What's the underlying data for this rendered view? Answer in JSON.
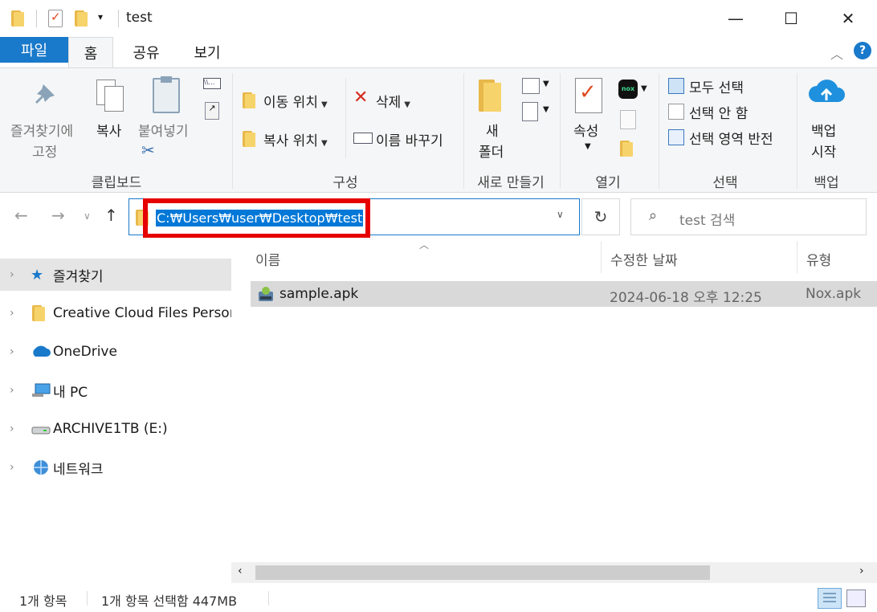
{
  "window": {
    "title": "test",
    "minimize": "—",
    "maximize": "☐",
    "close": "✕"
  },
  "ribbon_tabs": [
    {
      "label": "파일"
    },
    {
      "label": "홈"
    },
    {
      "label": "공유"
    },
    {
      "label": "보기"
    }
  ],
  "ribbon": {
    "clipboard": {
      "pin_line1": "즐겨찾기에",
      "pin_line2": "고정",
      "copy": "복사",
      "paste": "붙여넣기",
      "group": "클립보드"
    },
    "organize": {
      "move_to": "이동 위치",
      "copy_to": "복사 위치",
      "delete": "삭제",
      "rename": "이름 바꾸기",
      "group": "구성"
    },
    "new": {
      "folder_line1": "새",
      "folder_line2": "폴더",
      "group": "새로 만들기"
    },
    "open": {
      "properties": "속성",
      "group": "열기"
    },
    "select": {
      "select_all": "모두 선택",
      "select_none": "선택 안 함",
      "invert": "선택 영역 반전",
      "group": "선택"
    },
    "backup": {
      "start_line1": "백업",
      "start_line2": "시작",
      "group": "백업"
    }
  },
  "address": {
    "path": "C:₩Users₩user₩Desktop₩test",
    "search_placeholder": "test 검색"
  },
  "nav": [
    {
      "label": "즐겨찾기",
      "icon": "star-icon"
    },
    {
      "label": "Creative Cloud Files Person",
      "icon": "folder-icon"
    },
    {
      "label": "OneDrive",
      "icon": "cloud-icon"
    },
    {
      "label": "내 PC",
      "icon": "pc-icon"
    },
    {
      "label": "ARCHIVE1TB (E:)",
      "icon": "drive-icon"
    },
    {
      "label": "네트워크",
      "icon": "network-icon"
    }
  ],
  "columns": {
    "name": "이름",
    "modified": "수정한 날짜",
    "type": "유형"
  },
  "files": [
    {
      "name": "sample.apk",
      "modified": "2024-06-18 오후 12:25",
      "type": "Nox.apk"
    }
  ],
  "status": {
    "count": "1개 항목",
    "selected": "1개 항목 선택함 447MB"
  },
  "colors": {
    "accent": "#1979ca",
    "selection": "#0078d7",
    "highlight_box": "#e60000"
  }
}
